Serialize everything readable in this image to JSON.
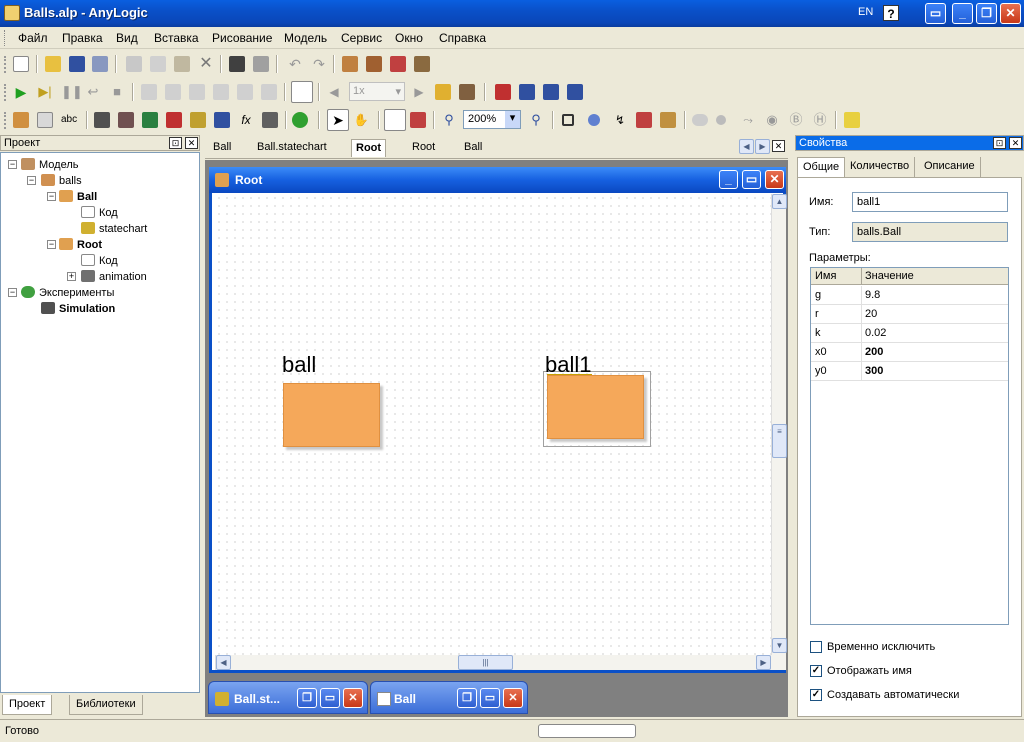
{
  "window": {
    "title": "Balls.alp - AnyLogic",
    "lang": "EN",
    "help": "?"
  },
  "menu": [
    "Файл",
    "Правка",
    "Вид",
    "Вставка",
    "Рисование",
    "Модель",
    "Сервис",
    "Окно",
    "Справка"
  ],
  "toolbar": {
    "speed": "1x",
    "zoom": "200%"
  },
  "project_panel": {
    "title": "Проект",
    "tree": {
      "model": "Модель",
      "balls": "balls",
      "ball": "Ball",
      "ball_code": "Код",
      "ball_statechart": "statechart",
      "root": "Root",
      "root_code": "Код",
      "root_animation": "animation",
      "experiments": "Эксперименты",
      "simulation": "Simulation"
    },
    "tabs": [
      "Проект",
      "Библиотеки"
    ]
  },
  "editor": {
    "tabs": [
      "Ball",
      "Ball.statechart",
      "Root",
      "Root",
      "Ball"
    ],
    "window_title": "Root",
    "objects": [
      {
        "label": "ball"
      },
      {
        "label": "ball1"
      }
    ],
    "minimized": [
      "Ball.st...",
      "Ball"
    ]
  },
  "properties": {
    "title": "Свойства",
    "tabs": [
      "Общие",
      "Количество",
      "Описание"
    ],
    "name_label": "Имя:",
    "name_value": "ball1",
    "type_label": "Тип:",
    "type_value": "balls.Ball",
    "params_label": "Параметры:",
    "table_headers": [
      "Имя",
      "Значение"
    ],
    "rows": [
      {
        "name": "g",
        "value": "9.8",
        "bold": false
      },
      {
        "name": "r",
        "value": "20",
        "bold": false
      },
      {
        "name": "k",
        "value": "0.02",
        "bold": false
      },
      {
        "name": "x0",
        "value": "200",
        "bold": true
      },
      {
        "name": "y0",
        "value": "300",
        "bold": true
      }
    ],
    "checkboxes": [
      {
        "label": "Временно исключить",
        "checked": false
      },
      {
        "label": "Отображать имя",
        "checked": true
      },
      {
        "label": "Создавать автоматически",
        "checked": true
      }
    ]
  },
  "status": {
    "text": "Готово"
  }
}
